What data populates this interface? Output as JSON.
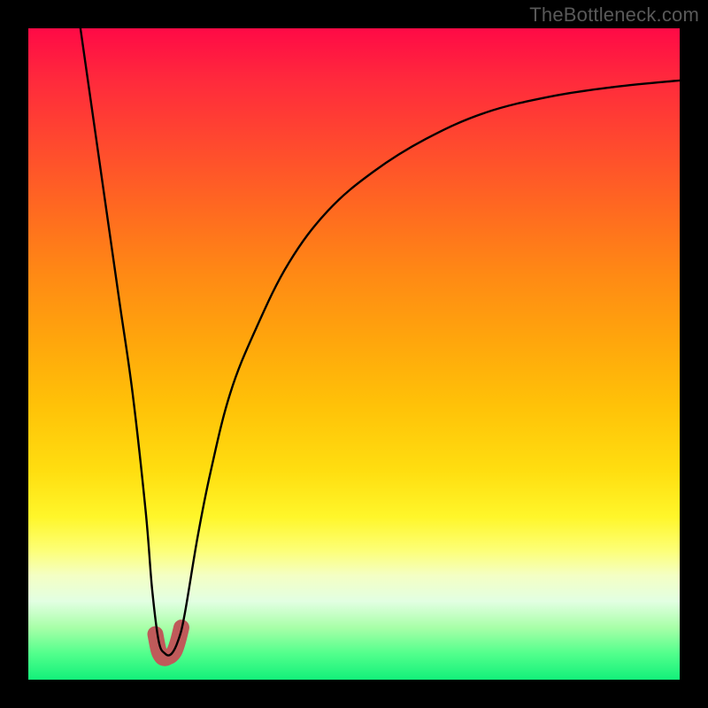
{
  "watermark": "TheBottleneck.com",
  "chart_data": {
    "type": "line",
    "title": "",
    "xlabel": "",
    "ylabel": "",
    "xlim": [
      0,
      100
    ],
    "ylim": [
      0,
      100
    ],
    "grid": false,
    "series": [
      {
        "name": "bottleneck-curve",
        "x": [
          8,
          10,
          12,
          14,
          16,
          18,
          19,
          20,
          21,
          22,
          23,
          24,
          26,
          28,
          31,
          35,
          40,
          46,
          53,
          61,
          70,
          80,
          90,
          100
        ],
        "y": [
          100,
          86,
          72,
          58,
          44,
          26,
          14,
          6,
          4,
          4,
          6,
          10,
          22,
          32,
          44,
          54,
          64,
          72,
          78,
          83,
          87,
          89.5,
          91,
          92
        ]
      },
      {
        "name": "minimum-marker",
        "x": [
          19.5,
          20,
          20.5,
          21,
          21.5,
          22,
          22.5,
          23,
          23.5
        ],
        "y": [
          7,
          4.5,
          3.5,
          3.3,
          3.5,
          3.8,
          4.5,
          6,
          8
        ]
      }
    ],
    "annotations": [],
    "colors": {
      "curve": "#000000",
      "marker": "#bf5a5a",
      "background_gradient": [
        "#ff0a46",
        "#ffde10",
        "#13f07a"
      ]
    }
  }
}
